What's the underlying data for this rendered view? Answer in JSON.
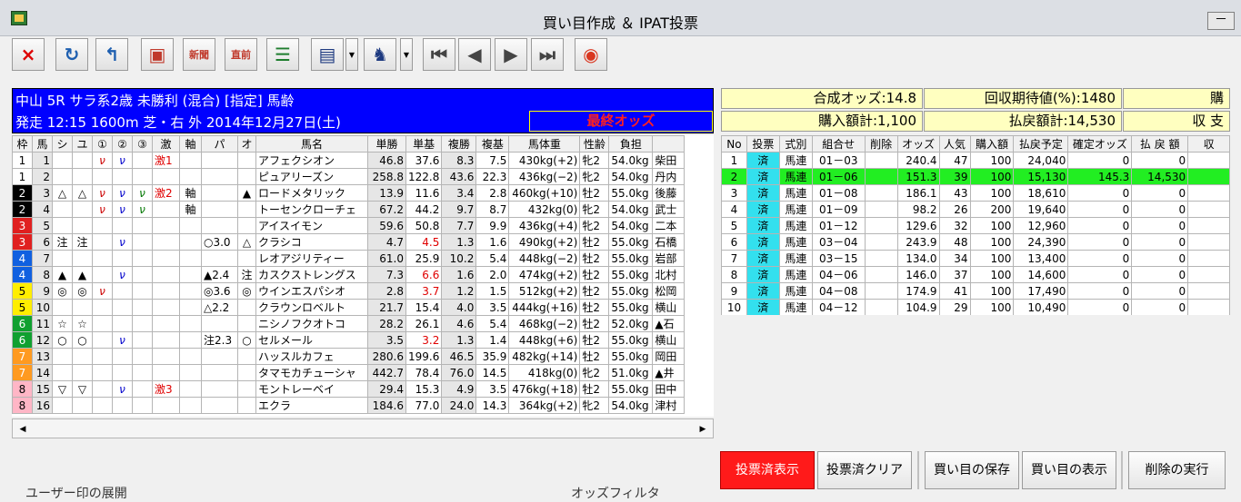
{
  "window": {
    "title": "買い目作成 ＆ IPAT投票",
    "minimize": "－"
  },
  "toolbar": [
    {
      "name": "close-x-icon",
      "label": "×",
      "color": "#dd0000"
    },
    {
      "name": "refresh-icon",
      "label": "↻",
      "color": "#1e5fb0"
    },
    {
      "name": "return-icon",
      "label": "↰",
      "color": "#1e5fb0"
    },
    {
      "name": "screen-icon",
      "label": "▣",
      "color": "#c0392b"
    },
    {
      "name": "newspaper-icon",
      "label": "新聞",
      "color": "#c0392b"
    },
    {
      "name": "jikkyou-icon",
      "label": "直前",
      "color": "#c0392b"
    },
    {
      "name": "numbered-list-icon",
      "label": "☰",
      "color": "#1e7d2e"
    },
    {
      "name": "document-icon",
      "label": "▤",
      "color": "#1e3a80"
    },
    {
      "name": "horse-check-icon",
      "label": "♞",
      "color": "#1e3a80"
    },
    {
      "name": "first-icon",
      "label": "⏮",
      "color": "#444444"
    },
    {
      "name": "prev-icon",
      "label": "◀",
      "color": "#444444"
    },
    {
      "name": "next-icon",
      "label": "▶",
      "color": "#444444"
    },
    {
      "name": "last-icon",
      "label": "⏭",
      "color": "#444444"
    },
    {
      "name": "horse-logo-icon",
      "label": "◉",
      "color": "#d9361f"
    }
  ],
  "race": {
    "line1": "中山 5R サラ系2歳 未勝利 (混合) [指定] 馬齢",
    "line2": "発走 12:15 1600m  芝・右  外       2014年12月27日(土)",
    "odds_label": "最終オッズ"
  },
  "left_columns": [
    "枠",
    "馬",
    "シ",
    "ユ",
    "①",
    "②",
    "③",
    "激",
    "軸",
    "パ",
    "オ",
    "馬名",
    "単勝",
    "単基",
    "複勝",
    "複基",
    "馬体重",
    "性齢",
    "負担",
    ""
  ],
  "left_rows": [
    {
      "waku": "1",
      "uma": "1",
      "shi": "",
      "yu": "",
      "c1": "ν",
      "c2": "ν",
      "c3": "",
      "geki": "激1",
      "jiku": "",
      "pa": "",
      "o": "",
      "name": "アフェクシオン",
      "tan": "46.8",
      "tanki": "37.6",
      "fuku": "8.3",
      "fukuki": "7.5",
      "weight": "430kg(+2)",
      "sex": "牝2",
      "load": "54.0kg",
      "jockey": "柴田",
      "redki": false
    },
    {
      "waku": "1",
      "uma": "2",
      "shi": "",
      "yu": "",
      "c1": "",
      "c2": "",
      "c3": "",
      "geki": "",
      "jiku": "",
      "pa": "",
      "o": "",
      "name": "ピュアリーズン",
      "tan": "258.8",
      "tanki": "122.8",
      "fuku": "43.6",
      "fukuki": "22.3",
      "weight": "436kg(−2)",
      "sex": "牝2",
      "load": "54.0kg",
      "jockey": "丹内",
      "redki": false
    },
    {
      "waku": "2",
      "uma": "3",
      "shi": "△",
      "yu": "△",
      "c1": "ν",
      "c2": "ν",
      "c3": "ν",
      "geki": "激2",
      "jiku": "軸",
      "pa": "",
      "o": "▲",
      "name": "ロードメタリック",
      "tan": "13.9",
      "tanki": "11.6",
      "fuku": "3.4",
      "fukuki": "2.8",
      "weight": "460kg(+10)",
      "sex": "牡2",
      "load": "55.0kg",
      "jockey": "後藤",
      "redki": false
    },
    {
      "waku": "2",
      "uma": "4",
      "shi": "",
      "yu": "",
      "c1": "ν",
      "c2": "ν",
      "c3": "ν",
      "geki": "",
      "jiku": "軸",
      "pa": "",
      "o": "",
      "name": "トーセンクローチェ",
      "tan": "67.2",
      "tanki": "44.2",
      "fuku": "9.7",
      "fukuki": "8.7",
      "weight": "432kg(0)",
      "sex": "牝2",
      "load": "54.0kg",
      "jockey": "武士",
      "redki": false
    },
    {
      "waku": "3",
      "uma": "5",
      "shi": "",
      "yu": "",
      "c1": "",
      "c2": "",
      "c3": "",
      "geki": "",
      "jiku": "",
      "pa": "",
      "o": "",
      "name": "アイスイモン",
      "tan": "59.6",
      "tanki": "50.8",
      "fuku": "7.7",
      "fukuki": "9.9",
      "weight": "436kg(+4)",
      "sex": "牝2",
      "load": "54.0kg",
      "jockey": "二本",
      "redki": false
    },
    {
      "waku": "3",
      "uma": "6",
      "shi": "注",
      "yu": "注",
      "c1": "",
      "c2": "ν",
      "c3": "",
      "geki": "",
      "jiku": "",
      "pa": "○3.0",
      "o": "△",
      "name": "クラシコ",
      "tan": "4.7",
      "tanki": "4.5",
      "fuku": "1.3",
      "fukuki": "1.6",
      "weight": "490kg(+2)",
      "sex": "牡2",
      "load": "55.0kg",
      "jockey": "石橋",
      "redki": true
    },
    {
      "waku": "4",
      "uma": "7",
      "shi": "",
      "yu": "",
      "c1": "",
      "c2": "",
      "c3": "",
      "geki": "",
      "jiku": "",
      "pa": "",
      "o": "",
      "name": "レオアジリティー",
      "tan": "61.0",
      "tanki": "25.9",
      "fuku": "10.2",
      "fukuki": "5.4",
      "weight": "448kg(−2)",
      "sex": "牡2",
      "load": "55.0kg",
      "jockey": "岩部",
      "redki": false
    },
    {
      "waku": "4",
      "uma": "8",
      "shi": "▲",
      "yu": "▲",
      "c1": "",
      "c2": "ν",
      "c3": "",
      "geki": "",
      "jiku": "",
      "pa": "▲2.4",
      "o": "注",
      "name": "カスクストレングス",
      "tan": "7.3",
      "tanki": "6.6",
      "fuku": "1.6",
      "fukuki": "2.0",
      "weight": "474kg(+2)",
      "sex": "牡2",
      "load": "55.0kg",
      "jockey": "北村",
      "redki": true
    },
    {
      "waku": "5",
      "uma": "9",
      "shi": "◎",
      "yu": "◎",
      "c1": "ν",
      "c2": "",
      "c3": "",
      "geki": "",
      "jiku": "",
      "pa": "◎3.6",
      "o": "◎",
      "name": "ウインエスパシオ",
      "tan": "2.8",
      "tanki": "3.7",
      "fuku": "1.2",
      "fukuki": "1.5",
      "weight": "512kg(+2)",
      "sex": "牡2",
      "load": "55.0kg",
      "jockey": "松岡",
      "redki": true
    },
    {
      "waku": "5",
      "uma": "10",
      "shi": "",
      "yu": "",
      "c1": "",
      "c2": "",
      "c3": "",
      "geki": "",
      "jiku": "",
      "pa": "△2.2",
      "o": "",
      "name": "クラウンロベルト",
      "tan": "21.7",
      "tanki": "15.4",
      "fuku": "4.0",
      "fukuki": "3.5",
      "weight": "444kg(+16)",
      "sex": "牡2",
      "load": "55.0kg",
      "jockey": "横山",
      "redki": false
    },
    {
      "waku": "6",
      "uma": "11",
      "shi": "☆",
      "yu": "☆",
      "c1": "",
      "c2": "",
      "c3": "",
      "geki": "",
      "jiku": "",
      "pa": "",
      "o": "",
      "name": "ニシノフクオトコ",
      "tan": "28.2",
      "tanki": "26.1",
      "fuku": "4.6",
      "fukuki": "5.4",
      "weight": "468kg(−2)",
      "sex": "牡2",
      "load": "52.0kg",
      "jockey": "▲石",
      "redki": false
    },
    {
      "waku": "6",
      "uma": "12",
      "shi": "○",
      "yu": "○",
      "c1": "",
      "c2": "ν",
      "c3": "",
      "geki": "",
      "jiku": "",
      "pa": "注2.3",
      "o": "○",
      "name": "セルメール",
      "tan": "3.5",
      "tanki": "3.2",
      "fuku": "1.3",
      "fukuki": "1.4",
      "weight": "448kg(+6)",
      "sex": "牡2",
      "load": "55.0kg",
      "jockey": "横山",
      "redki": true
    },
    {
      "waku": "7",
      "uma": "13",
      "shi": "",
      "yu": "",
      "c1": "",
      "c2": "",
      "c3": "",
      "geki": "",
      "jiku": "",
      "pa": "",
      "o": "",
      "name": "ハッスルカフェ",
      "tan": "280.6",
      "tanki": "199.6",
      "fuku": "46.5",
      "fukuki": "35.9",
      "weight": "482kg(+14)",
      "sex": "牡2",
      "load": "55.0kg",
      "jockey": "岡田",
      "redki": false
    },
    {
      "waku": "7",
      "uma": "14",
      "shi": "",
      "yu": "",
      "c1": "",
      "c2": "",
      "c3": "",
      "geki": "",
      "jiku": "",
      "pa": "",
      "o": "",
      "name": "タマモカチューシャ",
      "tan": "442.7",
      "tanki": "78.4",
      "fuku": "76.0",
      "fukuki": "14.5",
      "weight": "418kg(0)",
      "sex": "牝2",
      "load": "51.0kg",
      "jockey": "▲井",
      "redki": false
    },
    {
      "waku": "8",
      "uma": "15",
      "shi": "▽",
      "yu": "▽",
      "c1": "",
      "c2": "ν",
      "c3": "",
      "geki": "激3",
      "jiku": "",
      "pa": "",
      "o": "",
      "name": "モントレーベイ",
      "tan": "29.4",
      "tanki": "15.3",
      "fuku": "4.9",
      "fukuki": "3.5",
      "weight": "476kg(+18)",
      "sex": "牡2",
      "load": "55.0kg",
      "jockey": "田中",
      "redki": false
    },
    {
      "waku": "8",
      "uma": "16",
      "shi": "",
      "yu": "",
      "c1": "",
      "c2": "",
      "c3": "",
      "geki": "",
      "jiku": "",
      "pa": "",
      "o": "",
      "name": "エクラ",
      "tan": "184.6",
      "tanki": "77.0",
      "fuku": "24.0",
      "fukuki": "14.3",
      "weight": "364kg(+2)",
      "sex": "牝2",
      "load": "54.0kg",
      "jockey": "津村",
      "redki": false
    }
  ],
  "waku_colors": {
    "1": "#ffffff",
    "2": "#000000",
    "3": "#e02020",
    "4": "#1060e0",
    "5": "#ffee00",
    "6": "#10a030",
    "7": "#ff9a20",
    "8": "#ffb6c6"
  },
  "waku_text": {
    "1": "#000000",
    "2": "#ffffff",
    "3": "#ffffff",
    "4": "#ffffff",
    "5": "#000000",
    "6": "#ffffff",
    "7": "#ffffff",
    "8": "#000000"
  },
  "summary": {
    "goseiodds": "合成オッズ:14.8",
    "kaishu": "回収期待値(%):1480",
    "kounyu": "購入額計:1,100",
    "haraimodoshi": "払戻額計:14,530",
    "cut1": "購",
    "cut2": "収 支"
  },
  "right_columns": [
    "No",
    "投票",
    "式別",
    "組合せ",
    "削除",
    "オッズ",
    "人気",
    "購入額",
    "払戻予定",
    "確定オッズ",
    "払 戻 額",
    "収"
  ],
  "right_rows": [
    {
      "no": "1",
      "vote": "済",
      "type": "馬連",
      "combo": "01－03",
      "del": "",
      "odds": "240.4",
      "ninki": "47",
      "amount": "100",
      "pred": "24,040",
      "fixed": "0",
      "pay": "0",
      "hit": false
    },
    {
      "no": "2",
      "vote": "済",
      "type": "馬連",
      "combo": "01－06",
      "del": "",
      "odds": "151.3",
      "ninki": "39",
      "amount": "100",
      "pred": "15,130",
      "fixed": "145.3",
      "pay": "14,530",
      "hit": true
    },
    {
      "no": "3",
      "vote": "済",
      "type": "馬連",
      "combo": "01－08",
      "del": "",
      "odds": "186.1",
      "ninki": "43",
      "amount": "100",
      "pred": "18,610",
      "fixed": "0",
      "pay": "0",
      "hit": false
    },
    {
      "no": "4",
      "vote": "済",
      "type": "馬連",
      "combo": "01－09",
      "del": "",
      "odds": "98.2",
      "ninki": "26",
      "amount": "200",
      "pred": "19,640",
      "fixed": "0",
      "pay": "0",
      "hit": false
    },
    {
      "no": "5",
      "vote": "済",
      "type": "馬連",
      "combo": "01－12",
      "del": "",
      "odds": "129.6",
      "ninki": "32",
      "amount": "100",
      "pred": "12,960",
      "fixed": "0",
      "pay": "0",
      "hit": false
    },
    {
      "no": "6",
      "vote": "済",
      "type": "馬連",
      "combo": "03－04",
      "del": "",
      "odds": "243.9",
      "ninki": "48",
      "amount": "100",
      "pred": "24,390",
      "fixed": "0",
      "pay": "0",
      "hit": false
    },
    {
      "no": "7",
      "vote": "済",
      "type": "馬連",
      "combo": "03－15",
      "del": "",
      "odds": "134.0",
      "ninki": "34",
      "amount": "100",
      "pred": "13,400",
      "fixed": "0",
      "pay": "0",
      "hit": false
    },
    {
      "no": "8",
      "vote": "済",
      "type": "馬連",
      "combo": "04－06",
      "del": "",
      "odds": "146.0",
      "ninki": "37",
      "amount": "100",
      "pred": "14,600",
      "fixed": "0",
      "pay": "0",
      "hit": false
    },
    {
      "no": "9",
      "vote": "済",
      "type": "馬連",
      "combo": "04－08",
      "del": "",
      "odds": "174.9",
      "ninki": "41",
      "amount": "100",
      "pred": "17,490",
      "fixed": "0",
      "pay": "0",
      "hit": false
    },
    {
      "no": "10",
      "vote": "済",
      "type": "馬連",
      "combo": "04－12",
      "del": "",
      "odds": "104.9",
      "ninki": "29",
      "amount": "100",
      "pred": "10,490",
      "fixed": "0",
      "pay": "0",
      "hit": false
    }
  ],
  "buttons": {
    "voted_show": "投票済表示",
    "voted_clear": "投票済クリア",
    "save": "買い目の保存",
    "show": "買い目の表示",
    "delete": "削除の実行"
  },
  "bottom_labels": {
    "left": "ユーザー印の展開",
    "right": "オッズフィルタ"
  },
  "scroll": {
    "left": "◀",
    "right": "▶"
  }
}
